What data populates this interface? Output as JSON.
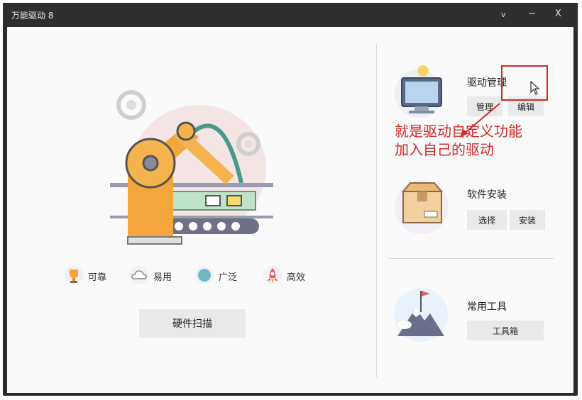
{
  "window": {
    "title": "万能驱动 8",
    "controls": {
      "dropdown": "v",
      "minimize": "−",
      "close": "X"
    }
  },
  "features": [
    {
      "icon": "trophy-icon",
      "label": "可靠"
    },
    {
      "icon": "cloud-icon",
      "label": "易用"
    },
    {
      "icon": "globe-icon",
      "label": "广泛"
    },
    {
      "icon": "rocket-icon",
      "label": "高效"
    }
  ],
  "scan_button": "硬件扫描",
  "sections": {
    "driver_manage": {
      "title": "驱动管理",
      "buttons": [
        "管理",
        "编辑"
      ]
    },
    "software_install": {
      "title": "软件安装",
      "buttons": [
        "选择",
        "安装"
      ]
    },
    "tools": {
      "title": "常用工具",
      "buttons": [
        "工具箱"
      ]
    }
  },
  "annotation": {
    "line1": "就是驱动自定义功能",
    "line2": "加入自己的驱动"
  },
  "colors": {
    "titlebar": "#2f2f2f",
    "accent_orange": "#f3a63b",
    "annotation_red": "#d62828",
    "button_bg": "#e9e9e9"
  }
}
